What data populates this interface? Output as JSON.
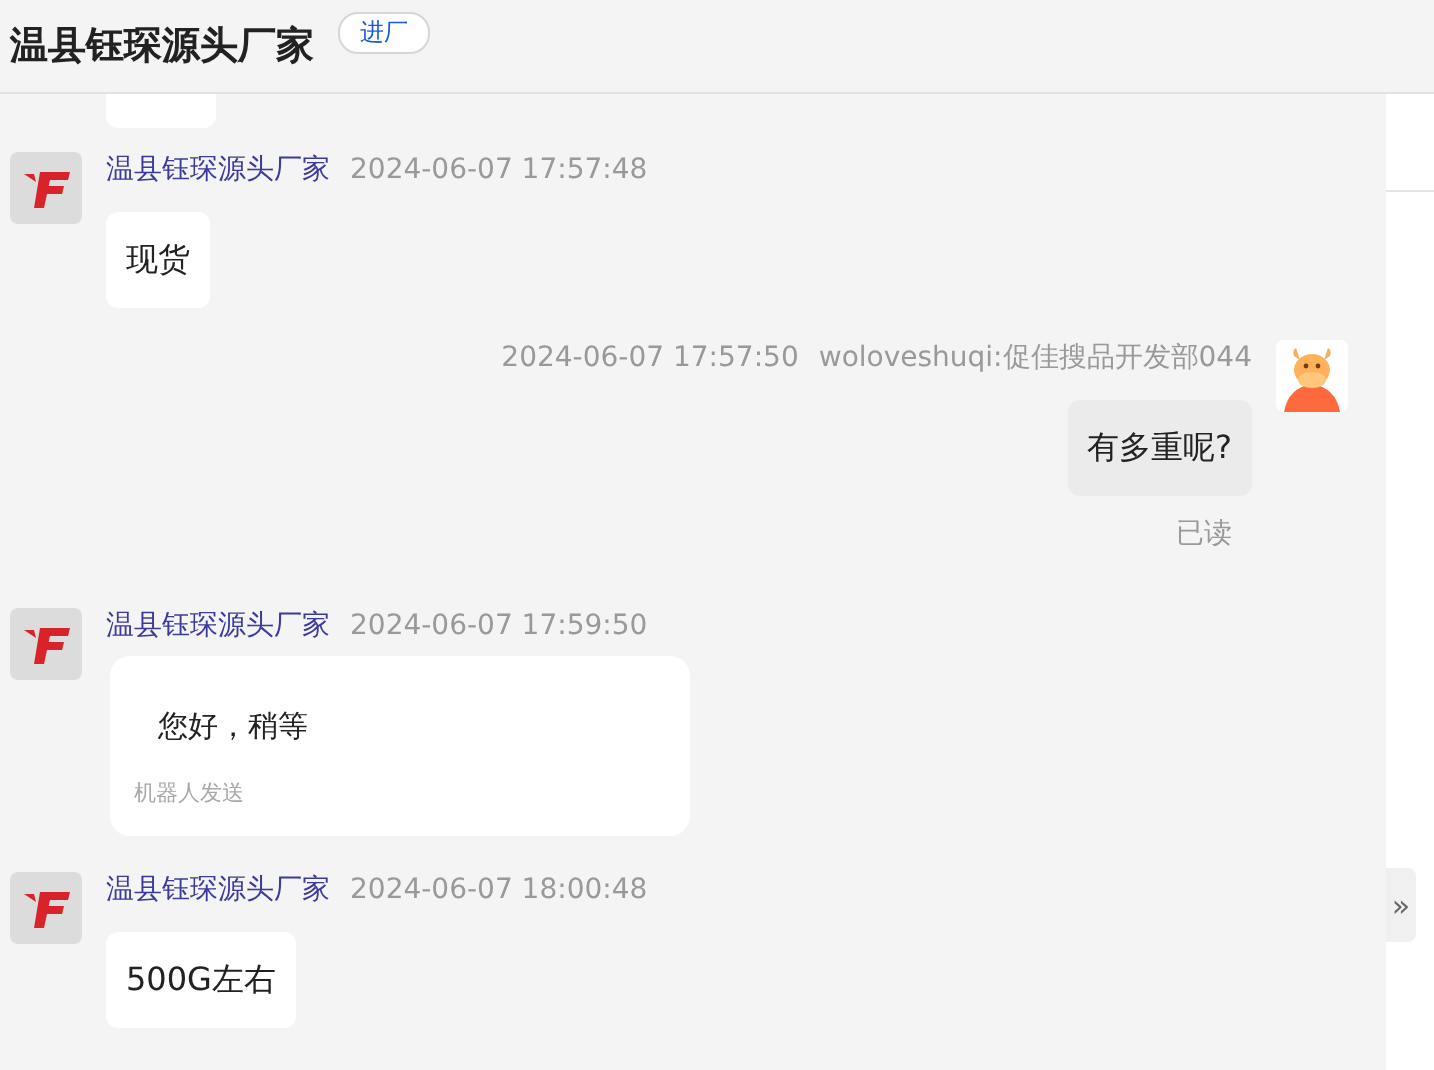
{
  "header": {
    "title": "温县钰琛源头厂家",
    "badge": "进厂"
  },
  "messages": [
    {
      "kind": "partial"
    },
    {
      "kind": "incoming",
      "sender": "温县钰琛源头厂家",
      "time": "2024-06-07 17:57:48",
      "text": "现货"
    },
    {
      "kind": "outgoing",
      "sender": "woloveshuqi:促佳搜品开发部044",
      "time": "2024-06-07 17:57:50",
      "text": "有多重呢?",
      "status": "已读"
    },
    {
      "kind": "bot",
      "sender": "温县钰琛源头厂家",
      "time": "2024-06-07 17:59:50",
      "text": "您好，稍等",
      "note": "机器人发送"
    },
    {
      "kind": "incoming",
      "sender": "温县钰琛源头厂家",
      "time": "2024-06-07 18:00:48",
      "text": "500G左右"
    }
  ],
  "side_toggle": "»"
}
